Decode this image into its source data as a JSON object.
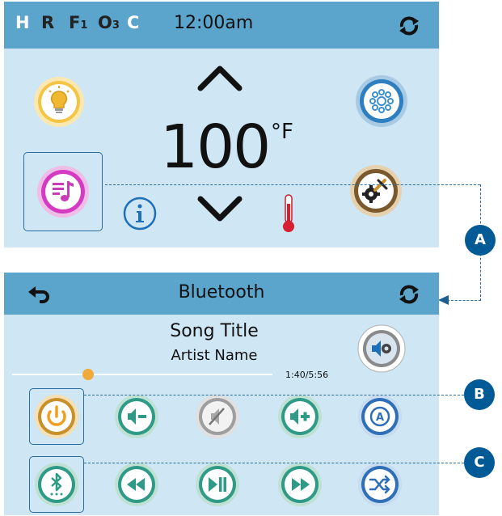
{
  "top_screen": {
    "status_indicators": [
      "H",
      "R",
      "F1",
      "O3",
      "C"
    ],
    "time": "12:00am",
    "temperature": "100",
    "temperature_unit": "°F",
    "icons": [
      "refresh-icon",
      "light-bulb-icon",
      "jets-icon",
      "music-icon",
      "info-icon",
      "up-arrow-icon",
      "down-arrow-icon",
      "thermometer-icon",
      "settings-icon"
    ]
  },
  "bluetooth_screen": {
    "title": "Bluetooth",
    "song_title": "Song Title",
    "artist_name": "Artist Name",
    "time_position": "1:40/5:56",
    "progress": 0.28,
    "row1_controls": [
      "power-button",
      "balance-left-button",
      "mute-button",
      "volume-up-button",
      "source-button"
    ],
    "row2_controls": [
      "bluetooth-pair-button",
      "rewind-button",
      "play-pause-button",
      "fast-forward-button",
      "shuffle-button"
    ]
  },
  "callouts": {
    "a": "A",
    "b": "B",
    "c": "C"
  },
  "colors": {
    "header_bar": "#5ba4cb",
    "screen_bg": "#cfe6f4",
    "callout": "#005a96",
    "teal": "#2f9b86",
    "gold": "#c8902a"
  }
}
